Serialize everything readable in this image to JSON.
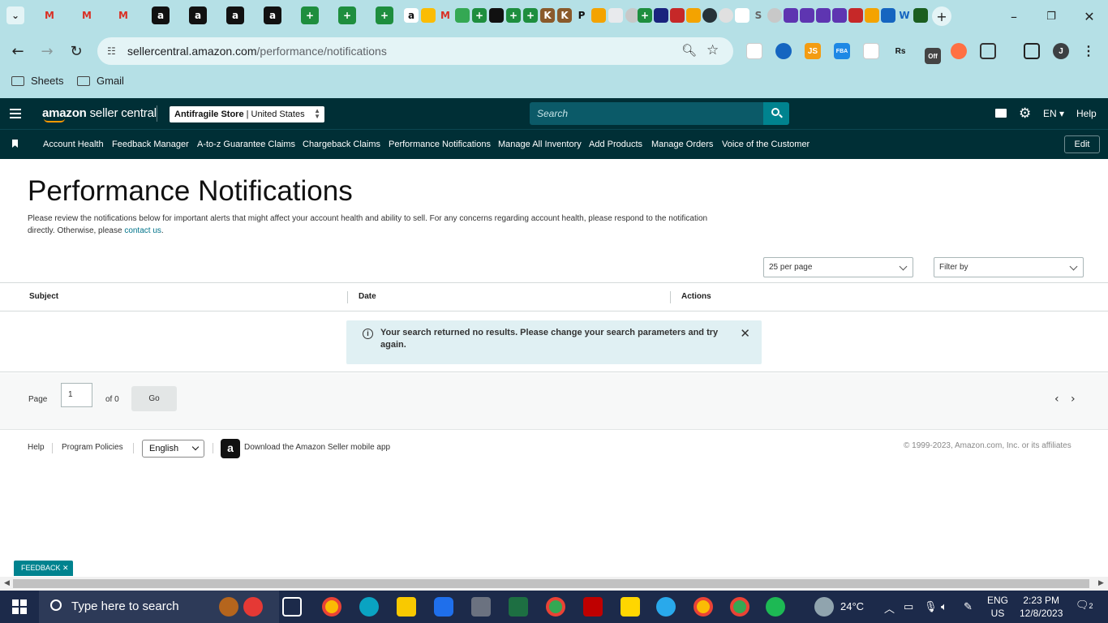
{
  "browser": {
    "url_domain": "sellercentral.amazon.com",
    "url_path": "/performance/notifications",
    "bookmarks": [
      "Sheets",
      "Gmail"
    ],
    "profile_initial": "J",
    "ext_labels": {
      "js": "JS",
      "fba": "FBA",
      "rs": "Rs",
      "off": "Off"
    }
  },
  "header": {
    "logo_text": "amazon",
    "logo_suffix": " seller central",
    "store_name": "Antifragile Store",
    "store_region": " | United States",
    "search_placeholder": "Search",
    "lang": "EN",
    "help": "Help"
  },
  "nav": {
    "items": [
      "Account Health",
      "Feedback Manager",
      "A-to-z Guarantee Claims",
      "Chargeback Claims",
      "Performance Notifications",
      "Manage All Inventory",
      "Add Products",
      "Manage Orders",
      "Voice of the Customer"
    ],
    "edit": "Edit"
  },
  "main": {
    "title": "Performance Notifications",
    "desc_before": "Please review the notifications below for important alerts that might affect your account health and ability to sell. For any concerns regarding account health, please respond to the notification directly. Otherwise, please ",
    "desc_link": "contact us",
    "desc_after": ".",
    "per_page": "25 per page",
    "filter": "Filter by",
    "columns": [
      "Subject",
      "Date",
      "Actions"
    ],
    "alert": "Your search returned no results. Please change your search parameters and try again."
  },
  "pager": {
    "page_label": "Page",
    "page_value": "1",
    "of": "of 0",
    "go": "Go"
  },
  "footer": {
    "help": "Help",
    "policies": "Program Policies",
    "language": "English",
    "app": "Download the Amazon Seller mobile app",
    "copyright": "© 1999-2023, Amazon.com, Inc. or its affiliates"
  },
  "feedback": "FEEDBACK",
  "taskbar": {
    "search": "Type here to search",
    "temp": "24°C",
    "lang1": "ENG",
    "lang2": "US",
    "time": "2:23 PM",
    "date": "12/8/2023",
    "notif_count": "2"
  },
  "colors": {
    "browser_bg": "#b5e0e6",
    "sc_dark": "#002f36",
    "accent": "#00838f"
  }
}
